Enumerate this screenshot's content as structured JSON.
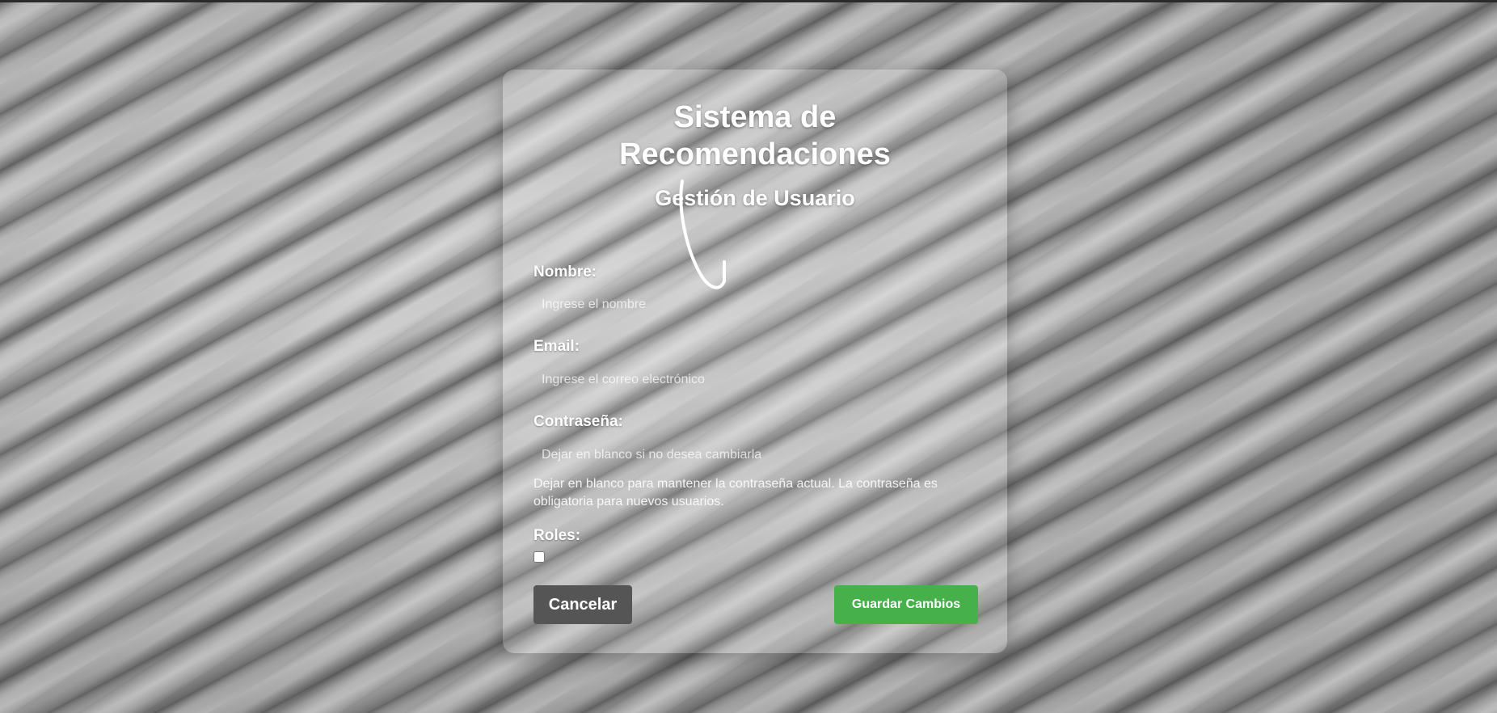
{
  "header": {
    "title_line1": "Sistema de",
    "title_line2": "Recomendaciones",
    "subtitle": "Gestión de Usuario"
  },
  "form": {
    "name_label": "Nombre:",
    "name_placeholder": "Ingrese el nombre",
    "name_value": "",
    "email_label": "Email:",
    "email_placeholder": "Ingrese el correo electrónico",
    "email_value": "",
    "password_label": "Contraseña:",
    "password_placeholder": "Dejar en blanco si no desea cambiarla",
    "password_value": "",
    "password_help": "Dejar en blanco para mantener la contraseña actual. La contraseña es obligatoria para nuevos usuarios.",
    "roles_label": "Roles:",
    "role_checked": false
  },
  "actions": {
    "cancel_label": "Cancelar",
    "save_label": "Guardar Cambios"
  },
  "colors": {
    "save_button": "#46b04a",
    "cancel_button": "#555555",
    "text": "#ffffff"
  },
  "icons": {
    "decoration": "swoosh-icon"
  }
}
